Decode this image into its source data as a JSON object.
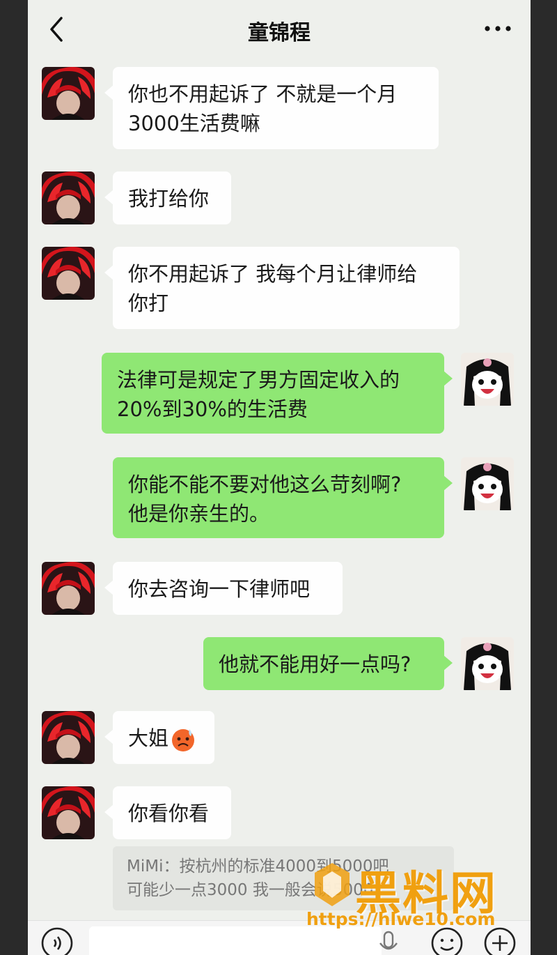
{
  "header": {
    "title": "童锦程"
  },
  "messages": [
    {
      "side": "in",
      "lines": [
        "你也不用起诉了 不就是一个月",
        "3000生活费嘛"
      ]
    },
    {
      "side": "in",
      "lines": [
        "我打给你"
      ]
    },
    {
      "side": "in",
      "lines": [
        "你不用起诉了 我每个月让律师给",
        "你打"
      ]
    },
    {
      "side": "out",
      "lines": [
        "法律可是规定了男方固定收入的",
        "20%到30%的生活费"
      ]
    },
    {
      "side": "out",
      "lines": [
        "你能不能不要对他这么苛刻啊?",
        "他是你亲生的。"
      ]
    },
    {
      "side": "in",
      "lines": [
        "你去咨询一下律师吧"
      ]
    },
    {
      "side": "out",
      "lines": [
        "他就不能用好一点吗?"
      ]
    },
    {
      "side": "in",
      "lines": [
        "大姐"
      ],
      "emoji": "frowning-sweat-emoji"
    },
    {
      "side": "in",
      "lines": [
        "你看你看"
      ]
    }
  ],
  "quote": {
    "line1": "MiMi：按杭州的标准4000到5000吧",
    "line2": "可能少一点3000 我一般会说5000"
  },
  "watermark": {
    "brand": "黑料网",
    "url": "https://hlwe10.com"
  },
  "colors": {
    "out_bubble": "#8fe774",
    "in_bubble": "#fefefe",
    "background": "#eef0ec",
    "watermark": "#f0a010"
  },
  "icons": [
    "back-arrow-icon",
    "more-dots-icon",
    "voice-icon",
    "mic-icon",
    "emoji-face-icon",
    "plus-icon"
  ]
}
